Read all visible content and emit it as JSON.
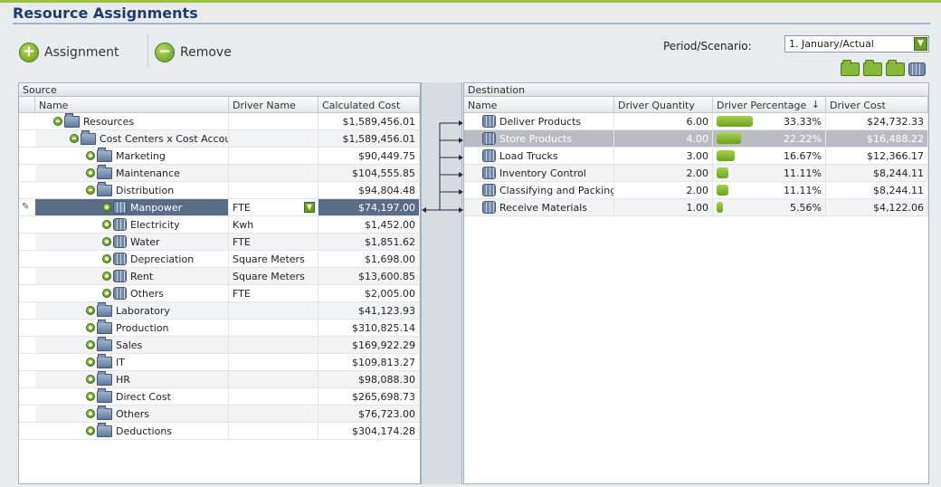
{
  "header": {
    "title": "Resource Assignments"
  },
  "toolbar": {
    "assignment_label": "Assignment",
    "remove_label": "Remove",
    "assignment_glyph": "+",
    "remove_glyph": "−"
  },
  "period": {
    "label": "Period/Scenario:",
    "value": "1. January/Actual",
    "arrow": "▼"
  },
  "source": {
    "title": "Source",
    "columns": [
      "Name",
      "Driver Name",
      "Calculated Cost"
    ],
    "rows": [
      {
        "name": "Resources",
        "driver": "",
        "cost": "$1,589,456.01",
        "level": 0,
        "icon": "folder",
        "expander": "minus"
      },
      {
        "name": "Cost Centers x Cost Accounts",
        "driver": "",
        "cost": "$1,589,456.01",
        "level": 1,
        "icon": "folder",
        "expander": "minus"
      },
      {
        "name": "Marketing",
        "driver": "",
        "cost": "$90,449.75",
        "level": 2,
        "icon": "folder",
        "expander": "plus"
      },
      {
        "name": "Maintenance",
        "driver": "",
        "cost": "$104,555.85",
        "level": 2,
        "icon": "folder",
        "expander": "plus"
      },
      {
        "name": "Distribution",
        "driver": "",
        "cost": "$94,804.48",
        "level": 2,
        "icon": "folder",
        "expander": "minus"
      },
      {
        "name": "Manpower",
        "driver": "FTE",
        "cost": "$74,197.00",
        "level": 3,
        "icon": "resource",
        "expander": "plus",
        "selected": true
      },
      {
        "name": "Electricity",
        "driver": "Kwh",
        "cost": "$1,452.00",
        "level": 3,
        "icon": "resource",
        "expander": "plus"
      },
      {
        "name": "Water",
        "driver": "FTE",
        "cost": "$1,851.62",
        "level": 3,
        "icon": "resource",
        "expander": "plus"
      },
      {
        "name": "Depreciation",
        "driver": "Square Meters",
        "cost": "$1,698.00",
        "level": 3,
        "icon": "resource",
        "expander": "plus"
      },
      {
        "name": "Rent",
        "driver": "Square Meters",
        "cost": "$13,600.85",
        "level": 3,
        "icon": "resource",
        "expander": "plus"
      },
      {
        "name": "Others",
        "driver": "FTE",
        "cost": "$2,005.00",
        "level": 3,
        "icon": "resource",
        "expander": "plus"
      },
      {
        "name": "Laboratory",
        "driver": "",
        "cost": "$41,123.93",
        "level": 2,
        "icon": "folder",
        "expander": "plus"
      },
      {
        "name": "Production",
        "driver": "",
        "cost": "$310,825.14",
        "level": 2,
        "icon": "folder",
        "expander": "plus"
      },
      {
        "name": "Sales",
        "driver": "",
        "cost": "$169,922.29",
        "level": 2,
        "icon": "folder",
        "expander": "plus"
      },
      {
        "name": "IT",
        "driver": "",
        "cost": "$109,813.27",
        "level": 2,
        "icon": "folder",
        "expander": "plus"
      },
      {
        "name": "HR",
        "driver": "",
        "cost": "$98,088.30",
        "level": 2,
        "icon": "folder",
        "expander": "plus"
      },
      {
        "name": "Direct Cost",
        "driver": "",
        "cost": "$265,698.73",
        "level": 2,
        "icon": "folder",
        "expander": "plus"
      },
      {
        "name": "Others",
        "driver": "",
        "cost": "$76,723.00",
        "level": 2,
        "icon": "folder",
        "expander": "plus"
      },
      {
        "name": "Deductions",
        "driver": "",
        "cost": "$304,174.28",
        "level": 2,
        "icon": "folder",
        "expander": "plus"
      }
    ]
  },
  "destination": {
    "title": "Destination",
    "columns": [
      "Name",
      "Driver Quantity",
      "Driver Percentage",
      "Driver Cost"
    ],
    "sort_glyph": "↓",
    "rows": [
      {
        "name": "Deliver Products",
        "qty": "6.00",
        "pct": "33.33%",
        "pct_value": 33.33,
        "cost": "$24,732.33"
      },
      {
        "name": "Store Products",
        "qty": "4.00",
        "pct": "22.22%",
        "pct_value": 22.22,
        "cost": "$16,488.22",
        "highlighted": true
      },
      {
        "name": "Load Trucks",
        "qty": "3.00",
        "pct": "16.67%",
        "pct_value": 16.67,
        "cost": "$12,366.17"
      },
      {
        "name": "Inventory Control",
        "qty": "2.00",
        "pct": "11.11%",
        "pct_value": 11.11,
        "cost": "$8,244.11"
      },
      {
        "name": "Classifying and Packing",
        "qty": "2.00",
        "pct": "11.11%",
        "pct_value": 11.11,
        "cost": "$8,244.11"
      },
      {
        "name": "Receive Materials",
        "qty": "1.00",
        "pct": "5.56%",
        "pct_value": 5.56,
        "cost": "$4,122.06"
      }
    ]
  },
  "colors": {
    "accent": "#9bc23c",
    "title": "#1f3b6e",
    "selection": "#5b6c85"
  }
}
